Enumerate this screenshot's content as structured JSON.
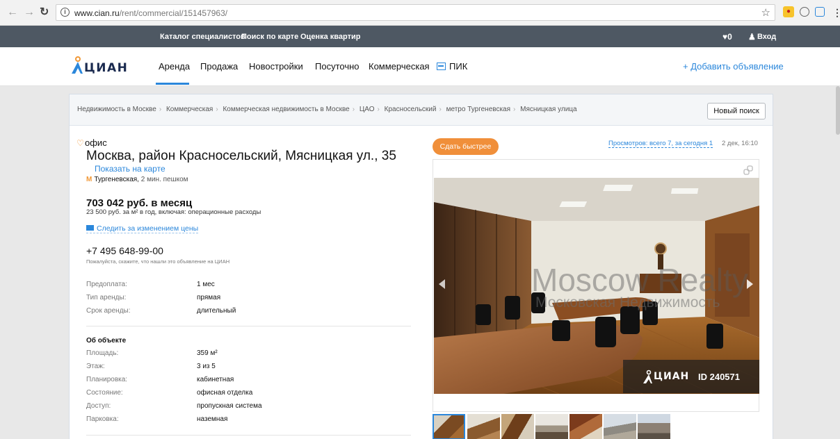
{
  "browser": {
    "url_host": "www.cian.ru",
    "url_path": "/rent/commercial/151457963/"
  },
  "topbar": {
    "links": [
      "Каталог специалистов",
      "Поиск по карте",
      "Оценка квартир"
    ],
    "favorites": "♥0",
    "login": "Вход"
  },
  "nav": {
    "logo": "ЦИАН",
    "items": [
      "Аренда",
      "Продажа",
      "Новостройки",
      "Посуточно",
      "Коммерческая"
    ],
    "pik": "ПИК",
    "add_listing": "+ Добавить объявление"
  },
  "breadcrumbs": [
    "Недвижимость в Москве",
    "Коммерческая",
    "Коммерческая недвижимость в Москве",
    "ЦАО",
    "Красносельский",
    "метро Тургеневская",
    "Мясницкая улица"
  ],
  "new_search": "Новый поиск",
  "listing": {
    "type": "офис",
    "address": "Москва, район Красносельский, Мясницкая ул., 35",
    "show_on_map": "Показать на карте",
    "metro_name": "Тургеневская,",
    "metro_dist": " 2 мин. пешком",
    "price": "703 042 руб. в месяц",
    "price_sub": "23 500 руб. за м² в год, включая: операционные расходы",
    "follow_price": "Следить за изменением цены",
    "phone": "+7 495 648-99-00",
    "phone_note": "Пожалуйста, скажите, что нашли это объявление на ЦИАН",
    "terms": [
      {
        "label": "Предоплата:",
        "value": "1 мес"
      },
      {
        "label": "Тип аренды:",
        "value": "прямая"
      },
      {
        "label": "Срок аренды:",
        "value": "длительный"
      }
    ],
    "about_title": "Об объекте",
    "about": [
      {
        "label": "Площадь:",
        "value": "359 м²"
      },
      {
        "label": "Этаж:",
        "value": "3 из 5"
      },
      {
        "label": "Планировка:",
        "value": "кабинетная"
      },
      {
        "label": "Состояние:",
        "value": "офисная отделка"
      },
      {
        "label": "Доступ:",
        "value": "пропускная система"
      },
      {
        "label": "Парковка:",
        "value": "наземная"
      }
    ]
  },
  "right": {
    "rent_fast": "Сдать быстрее",
    "views": "Просмотров: всего 7, за сегодня 1",
    "date": "2 дек, 16:10",
    "watermark": "Moscow Realty",
    "watermark_sub": "Московская Недвижимость",
    "badge_logo": "ЦИАН",
    "badge_id": "ID 240571"
  },
  "colors": {
    "accent": "#2b87db",
    "orange": "#f08f3a",
    "topbar": "#4e5863"
  }
}
